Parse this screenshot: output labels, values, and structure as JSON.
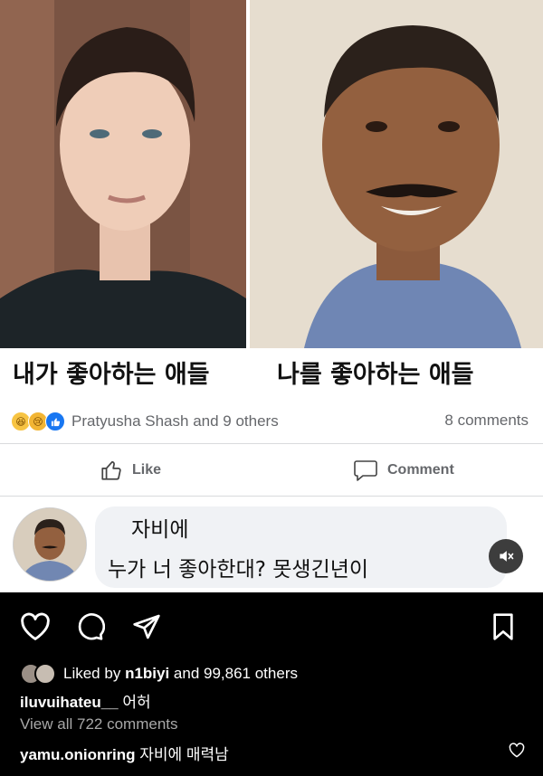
{
  "post": {
    "caption_left": "내가 좋아하는 애들",
    "caption_right": "나를 좋아하는 애들",
    "reactions": {
      "icons": [
        "haha-icon",
        "sad-icon",
        "like-icon"
      ],
      "reactors": "Pratyusha Shash and 9 others",
      "comments": "8 comments"
    },
    "buttons": {
      "like": "Like",
      "comment": "Comment"
    },
    "comment": {
      "name": "자비에",
      "text": "누가 너 좋아한대? 못생긴년이"
    }
  },
  "instagram": {
    "liked_by_prefix": "Liked by",
    "liked_by_user": "n1biyi",
    "liked_by_suffix": "and 99,861 others",
    "caption_user": "iluvuihateu__",
    "caption_text": "어허",
    "view_all": "View all 722 comments",
    "comment_user": "yamu.onionring",
    "comment_text": "자비에 매력남"
  },
  "colors": {
    "facebook_blue": "#1877f2",
    "meta_gray": "#65676b",
    "instagram_bg": "#000000"
  }
}
